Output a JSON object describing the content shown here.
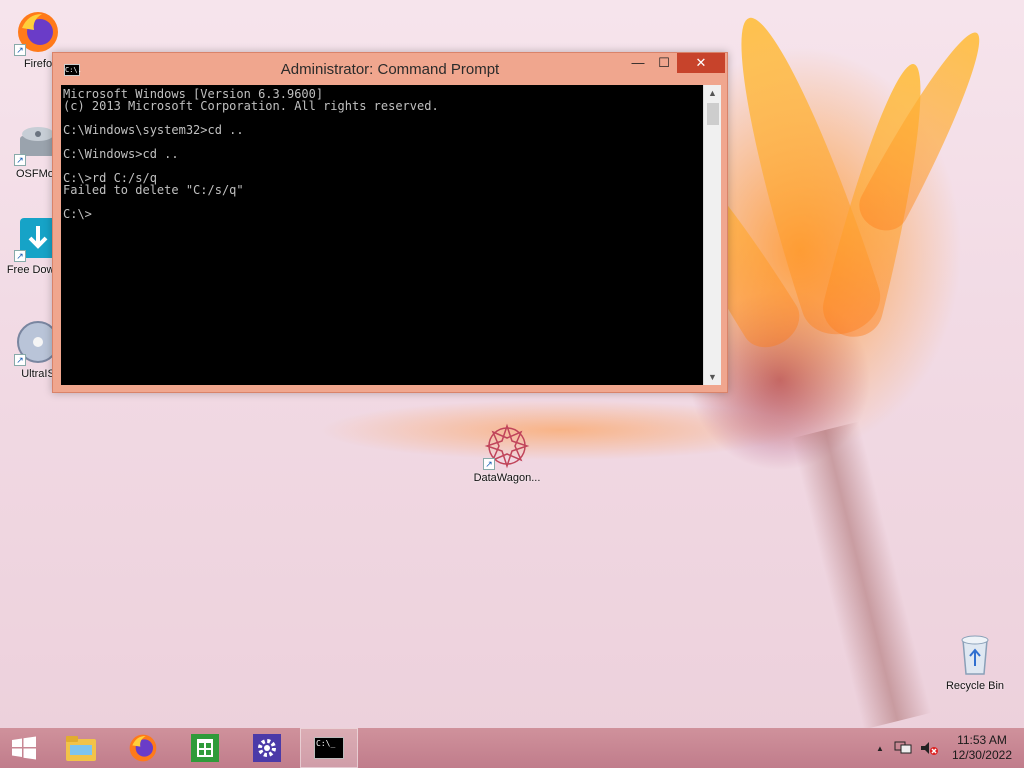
{
  "desktop": {
    "icons": [
      {
        "label": "Firefo"
      },
      {
        "label": "OSFMou"
      },
      {
        "label": "Free Downlo"
      },
      {
        "label": "UltraIS"
      },
      {
        "label": "DataWagon..."
      },
      {
        "label": "Recycle Bin"
      }
    ]
  },
  "window": {
    "title": "Administrator:  Command Prompt",
    "icon_text": "C:\\.",
    "minimize": "—",
    "maximize": "☐",
    "close": "✕",
    "console_lines": [
      "Microsoft Windows [Version 6.3.9600]",
      "(c) 2013 Microsoft Corporation. All rights reserved.",
      "",
      "C:\\Windows\\system32>cd ..",
      "",
      "C:\\Windows>cd ..",
      "",
      "C:\\>rd C:/s/q",
      "Failed to delete \"C:/s/q\"",
      "",
      "C:\\>"
    ]
  },
  "taskbar": {
    "start_icon": "windows-logo-icon",
    "items": [
      {
        "name": "file-explorer-icon"
      },
      {
        "name": "firefox-icon"
      },
      {
        "name": "store-icon"
      },
      {
        "name": "settings-icon"
      },
      {
        "name": "command-prompt-icon",
        "text": "C:\\_"
      }
    ],
    "tray": {
      "chevron": "▲",
      "time": "11:53 AM",
      "date": "12/30/2022"
    }
  }
}
